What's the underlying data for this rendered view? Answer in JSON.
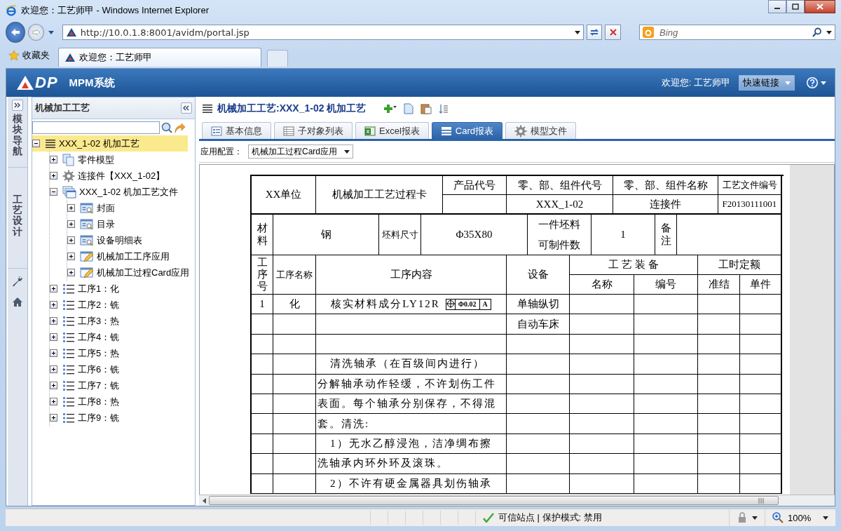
{
  "window": {
    "title": "欢迎您：工艺师甲 - Windows Internet Explorer"
  },
  "address_bar": {
    "url": "http://10.0.1.8:8001/avidm/portal.jsp"
  },
  "search": {
    "placeholder": "Bing"
  },
  "favorites": {
    "label": "收藏夹"
  },
  "browser_tabs": [
    {
      "title": "欢迎您：工艺师甲",
      "selected": true
    }
  ],
  "app_header": {
    "logo": "DP",
    "brand": "MPM系统",
    "welcome": "欢迎您: 工艺师甲",
    "quick_links": "快速链接"
  },
  "side_nav": [
    {
      "label": "模块导航"
    },
    {
      "label": "工艺设计"
    }
  ],
  "tree_panel": {
    "title": "机械加工工艺",
    "items": [
      {
        "label": "XXX_1-02 机加工艺",
        "kind": "list",
        "expanded": true,
        "selected": true,
        "children": [
          {
            "label": "零件模型",
            "kind": "part",
            "expanded": false,
            "selected": false
          },
          {
            "label": "连接件【XXX_1-02】",
            "kind": "gear",
            "expanded": false,
            "selected": false
          },
          {
            "label": "XXX_1-02 机加工艺文件",
            "kind": "docs",
            "expanded": true,
            "selected": false,
            "children": [
              {
                "label": "封面",
                "kind": "form",
                "expanded": false,
                "selected": false
              },
              {
                "label": "目录",
                "kind": "form",
                "expanded": false,
                "selected": false
              },
              {
                "label": "设备明细表",
                "kind": "form",
                "expanded": false,
                "selected": false
              },
              {
                "label": "机械加工工序应用",
                "kind": "edit",
                "expanded": false,
                "selected": false
              },
              {
                "label": "机械加工过程Card应用",
                "kind": "edit",
                "expanded": false,
                "selected": false
              }
            ]
          },
          {
            "label": "工序1：化",
            "kind": "steps",
            "expanded": false,
            "selected": false
          },
          {
            "label": "工序2：铣",
            "kind": "steps",
            "expanded": false,
            "selected": false
          },
          {
            "label": "工序3：热",
            "kind": "steps",
            "expanded": false,
            "selected": false
          },
          {
            "label": "工序4：铣",
            "kind": "steps",
            "expanded": false,
            "selected": false
          },
          {
            "label": "工序5：热",
            "kind": "steps",
            "expanded": false,
            "selected": false
          },
          {
            "label": "工序6：铣",
            "kind": "steps",
            "expanded": false,
            "selected": false
          },
          {
            "label": "工序7：铣",
            "kind": "steps",
            "expanded": false,
            "selected": false
          },
          {
            "label": "工序8：热",
            "kind": "steps",
            "expanded": false,
            "selected": false
          },
          {
            "label": "工序9：铣",
            "kind": "steps",
            "expanded": false,
            "selected": false
          }
        ]
      }
    ]
  },
  "content": {
    "title": "机械加工工艺:XXX_1-02 机加工艺",
    "tabs": [
      {
        "label": "基本信息",
        "kind": "info",
        "selected": false
      },
      {
        "label": "子对象列表",
        "kind": "list",
        "selected": false
      },
      {
        "label": "Excel报表",
        "kind": "excel",
        "selected": false
      },
      {
        "label": "Card报表",
        "kind": "card",
        "selected": true
      },
      {
        "label": "模型文件",
        "kind": "gear",
        "selected": false
      }
    ],
    "config_label": "应用配置：",
    "config_value": "机械加工过程Card应用"
  },
  "card": {
    "unit": "XX单位",
    "title": "机械加工工艺过程卡",
    "product_code": {
      "label": "产品代号"
    },
    "part_code": {
      "label": "零、部、组件代号",
      "value": "XXX_1-02"
    },
    "part_name": {
      "label": "零、部、组件名称",
      "value": "连接件"
    },
    "doc_no": {
      "label": "工艺文件编号",
      "value": "F20130111001"
    },
    "material_label": "材料",
    "material": "钢",
    "blank_size_label": "坯料尺寸",
    "blank_size": "Φ35X80",
    "pieces_label": "一件坯料可制件数",
    "pieces": "1",
    "remark_label": "备注",
    "columns": {
      "step_no": "工序号",
      "step_name": "工序名称",
      "content": "工序内容",
      "equipment": "设备",
      "tooling": "工 艺 装 备",
      "tool_name": "名称",
      "tool_no": "编号",
      "time": "工时定额",
      "prep": "准结",
      "unit_time": "单件"
    },
    "rows": [
      {
        "no": "1",
        "name": "化",
        "content": "核实材料成分LY12R",
        "tolerance": {
          "value": "Φ0.02",
          "datum": "A"
        },
        "equipment": "单轴纵切"
      },
      {
        "equipment": "自动车床"
      },
      {},
      {
        "content": "清洗轴承（在百级间内进行）",
        "indent": true
      },
      {
        "content": "分解轴承动作轻缓，不许划伤工件"
      },
      {
        "content": "表面。每个轴承分别保存，不得混"
      },
      {
        "content": "套。清洗:"
      },
      {
        "content": "1）无水乙醇浸泡，洁净绸布擦",
        "indent": true
      },
      {
        "content": "洗轴承内环外环及滚珠。"
      },
      {
        "content": "2）不许有硬金属器具划伤轴承",
        "indent": true
      }
    ]
  },
  "status_bar": {
    "zone": "可信站点 | 保护模式: 禁用",
    "zoom": "100%"
  }
}
